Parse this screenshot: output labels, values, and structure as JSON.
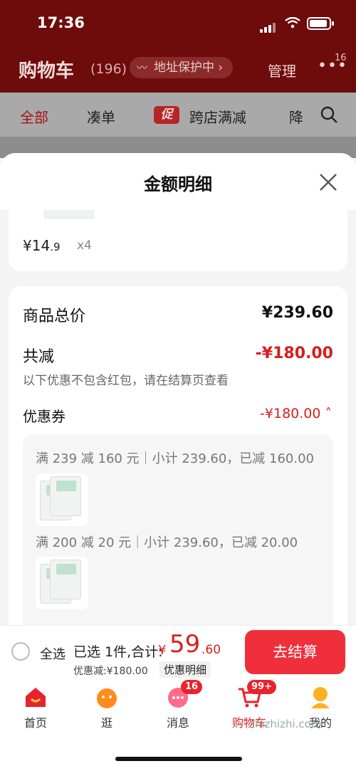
{
  "status": {
    "time": "17:36"
  },
  "header": {
    "title": "购物车",
    "count": "(196)",
    "address_pill": "地址保护中 ›",
    "manage": "管理",
    "more": "•••",
    "more_badge": "16"
  },
  "tabs": {
    "all": "全部",
    "bundle": "凑单",
    "promo_tag": "促",
    "cross_store": "跨店满减",
    "cutoff": "降"
  },
  "sheet": {
    "title": "金额明细",
    "item": {
      "price_main": "¥14",
      "price_dec": ".9",
      "qty": "x4"
    },
    "total_goods_label": "商品总价",
    "total_goods_value": "¥239.60",
    "total_discount_label": "共减",
    "total_discount_value": "-¥180.00",
    "hint": "以下优惠不包含红包，请在结算页查看",
    "coupon_label": "优惠券",
    "coupon_value": "-¥180.00 ˄",
    "coupon_rules": [
      "满 239 减 160 元｜小计 239.60，已减 160.00",
      "满 200 减 20 元｜小计 239.60，已减 20.00"
    ]
  },
  "checkout": {
    "select_all": "全选",
    "summary": "已选 1件,合计:",
    "currency": "¥",
    "total_int": "59",
    "total_dec": ".60",
    "discount_line": "优惠减:¥180.00",
    "detail_button": "优惠明细",
    "pay_button": "去结算"
  },
  "tabbar": {
    "items": [
      {
        "label": "首页"
      },
      {
        "label": "逛"
      },
      {
        "label": "消息",
        "badge": "16"
      },
      {
        "label": "购物车",
        "badge": "99+"
      },
      {
        "label": "我的"
      }
    ]
  },
  "watermark": "zhizhizhi.com",
  "colors": {
    "accent": "#ef2f3b",
    "header": "#6e0b0b",
    "price_red": "#d81e1e"
  }
}
